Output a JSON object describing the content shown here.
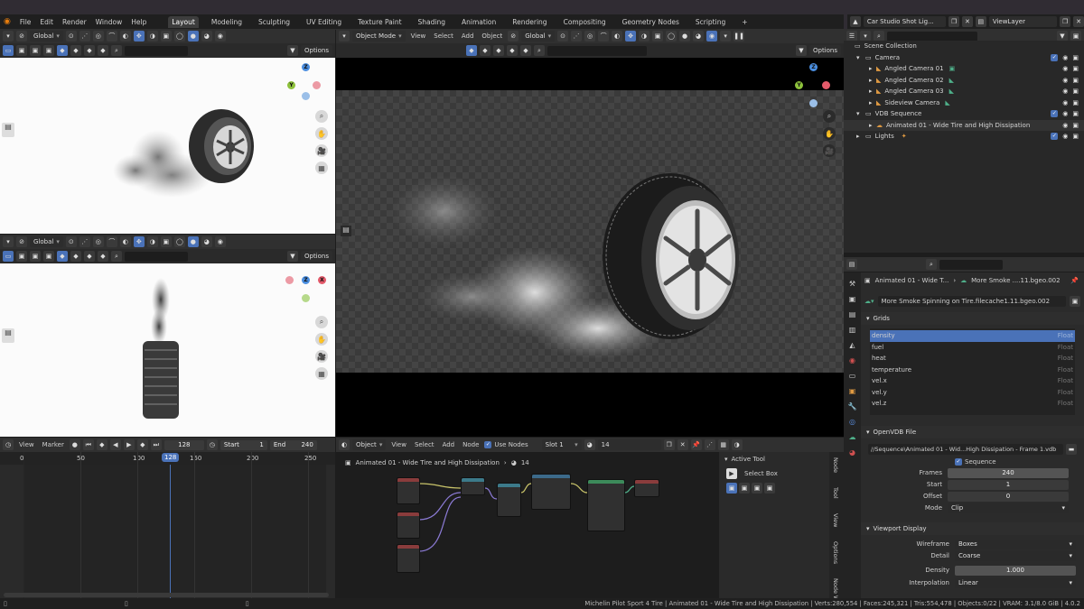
{
  "menus": [
    "File",
    "Edit",
    "Render",
    "Window",
    "Help"
  ],
  "workspace_tabs": [
    "Layout",
    "Modeling",
    "Sculpting",
    "UV Editing",
    "Texture Paint",
    "Shading",
    "Animation",
    "Rendering",
    "Compositing",
    "Geometry Nodes",
    "Scripting",
    "+"
  ],
  "active_tab": "Layout",
  "scene": {
    "name": "Car Studio Shot Lig...",
    "view_layer": "ViewLayer"
  },
  "viewport": {
    "mode": "Object Mode",
    "menu": [
      "View",
      "Select",
      "Add",
      "Object"
    ],
    "transform": "Global",
    "options": "Options",
    "small_transform": "Global",
    "small_options": "Options"
  },
  "gizmo": {
    "x": "X",
    "y": "Y",
    "z": "Z"
  },
  "outliner": {
    "root": "Scene Collection",
    "rows": [
      {
        "label": "Camera",
        "level": 1
      },
      {
        "label": "Angled Camera 01",
        "level": 2
      },
      {
        "label": "Angled Camera 02",
        "level": 2
      },
      {
        "label": "Angled Camera 03",
        "level": 2
      },
      {
        "label": "Sideview Camera",
        "level": 2
      },
      {
        "label": "VDB Sequence",
        "level": 1
      },
      {
        "label": "Animated 01 - Wide Tire and High Dissipation",
        "level": 2
      },
      {
        "label": "Lights",
        "level": 1
      }
    ]
  },
  "properties": {
    "breadcrumb_obj": "Animated 01 - Wide T...",
    "breadcrumb_data": "More Smoke ....11.bgeo.002",
    "datablock": "More Smoke Spinning on Tire.filecache1.11.bgeo.002",
    "grids_title": "Grids",
    "grids": [
      {
        "name": "density",
        "type": "Float"
      },
      {
        "name": "fuel",
        "type": "Float"
      },
      {
        "name": "heat",
        "type": "Float"
      },
      {
        "name": "temperature",
        "type": "Float"
      },
      {
        "name": "vel.x",
        "type": "Float"
      },
      {
        "name": "vel.y",
        "type": "Float"
      },
      {
        "name": "vel.z",
        "type": "Float"
      }
    ],
    "openvdb_title": "OpenVDB File",
    "filepath": "//Sequence\\Animated 01 - Wid...High Dissipation - Frame 1.vdb",
    "sequence_label": "Sequence",
    "frames_label": "Frames",
    "frames_value": "240",
    "start_label": "Start",
    "start_value": "1",
    "offset_label": "Offset",
    "offset_value": "0",
    "mode_label": "Mode",
    "mode_value": "Clip",
    "viewport_display_title": "Viewport Display",
    "wireframe_label": "Wireframe",
    "wireframe_value": "Boxes",
    "detail_label": "Detail",
    "detail_value": "Coarse",
    "density_label": "Density",
    "density_value": "1.000",
    "interpolation_label": "Interpolation",
    "interpolation_value": "Linear"
  },
  "timeline": {
    "menu": [
      "View",
      "Marker"
    ],
    "current_frame": "128",
    "start_label": "Start",
    "start_value": "1",
    "end_label": "End",
    "end_value": "240",
    "ticks": [
      "0",
      "50",
      "100",
      "128",
      "150",
      "200",
      "250"
    ]
  },
  "node_editor": {
    "type": "Object",
    "menu": [
      "View",
      "Select",
      "Add",
      "Node"
    ],
    "use_nodes": "Use Nodes",
    "slot": "Slot 1",
    "material_count": "14",
    "breadcrumb_obj": "Animated 01 - Wide Tire and High Dissipation",
    "breadcrumb_mat": "14",
    "side_tabs": [
      "Node",
      "Tool",
      "View",
      "Options",
      "Node Wr..."
    ],
    "active_tool_title": "Active Tool",
    "active_tool_name": "Select Box"
  },
  "status_bar": "Michelin Pilot Sport 4 Tire | Animated 01 - Wide Tire and High Dissipation | Verts:280,554 | Faces:245,321 | Tris:554,478 | Objects:0/22 | VRAM: 3.1/8.0 GiB | 4.0.2",
  "colors": {
    "accent": "#4a72b8",
    "x_axis": "#e35a6a",
    "y_axis": "#8dc13b",
    "z_axis": "#4a8ee0"
  }
}
